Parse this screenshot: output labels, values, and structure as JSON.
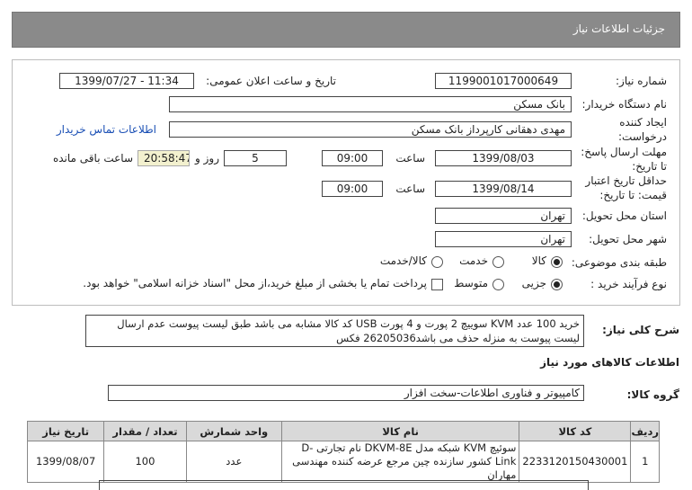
{
  "header": {
    "title": "جزئیات اطلاعات نیاز"
  },
  "form": {
    "need_number_label": "شماره نیاز:",
    "need_number": "1199001017000649",
    "announce_label": "تاریخ و ساعت اعلان عمومی:",
    "announce_value": "1399/07/27 - 11:34",
    "buyer_org_label": "نام دستگاه خریدار:",
    "buyer_org": "بانک مسکن",
    "requester_label_1": "ایجاد کننده",
    "requester_label_2": "درخواست:",
    "requester": "مهدی دهقانی کارپرداز بانک مسکن",
    "contact_link": "اطلاعات تماس خریدار",
    "deadline_label_1": "مهلت ارسال پاسخ:",
    "deadline_label_2": "تا تاریخ:",
    "deadline_date": "1399/08/03",
    "time_label": "ساعت",
    "deadline_time": "09:00",
    "days_value": "5",
    "days_label": "روز و",
    "remaining_time": "20:58:47",
    "remaining_label": "ساعت باقی مانده",
    "validity_label_1": "حداقل تاریخ اعتبار",
    "validity_label_2": "قیمت: تا تاریخ:",
    "validity_date": "1399/08/14",
    "validity_time": "09:00",
    "province_label": "استان محل تحویل:",
    "province": "تهران",
    "city_label": "شهر محل تحویل:",
    "city": "تهران",
    "category_label": "طبقه بندی موضوعی:",
    "category_options": [
      "کالا",
      "خدمت",
      "کالا/خدمت"
    ],
    "process_label": "نوع فرآیند خرید :",
    "process_options": [
      "جزیی",
      "متوسط"
    ],
    "payment_note": "پرداخت تمام یا بخشی از مبلغ خرید،از محل \"اسناد خزانه اسلامی\" خواهد بود."
  },
  "description": {
    "label": "شرح کلی نیاز:",
    "text": "خرید 100 عدد KVM سوییچ 2 پورت و 4 پورت USB کد کالا مشابه می باشد طبق لیست پیوست عدم ارسال لیست پیوست به منزله حذف می باشد26205036 فکس"
  },
  "goods": {
    "section_title": "اطلاعات کالاهای مورد نیاز",
    "group_label": "گروه کالا:",
    "group_value": "کامپیوتر و فناوری اطلاعات-سخت افزار",
    "columns": [
      "ردیف",
      "کد کالا",
      "نام کالا",
      "واحد شمارش",
      "تعداد / مقدار",
      "تاریخ نیاز"
    ],
    "rows": [
      {
        "row": "1",
        "code": "2233120150430001",
        "name": "سوئیچ KVM شبکه مدل DKVM-8E نام تجارتی D-Link کشور سازنده چین مرجع عرضه کننده مهندسی مهاران",
        "unit": "عدد",
        "qty": "100",
        "date": "1399/08/07"
      }
    ]
  }
}
